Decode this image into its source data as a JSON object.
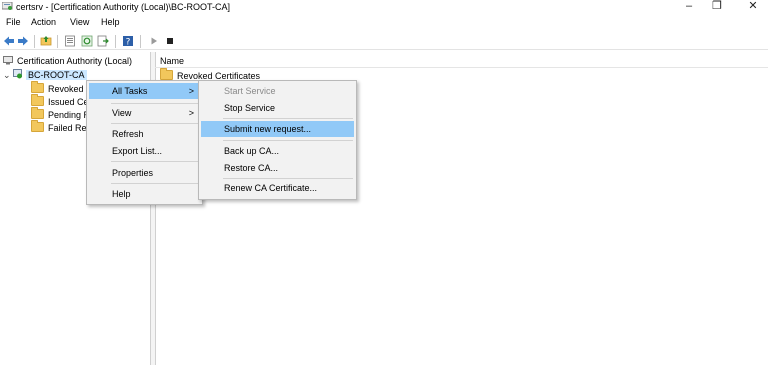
{
  "window": {
    "title": "certsrv - [Certification Authority (Local)\\BC-ROOT-CA]",
    "minimize": "–",
    "restore": "❐",
    "close": "✕"
  },
  "menubar": [
    "File",
    "Action",
    "View",
    "Help"
  ],
  "toolbar": {
    "icons": [
      "back-icon",
      "forward-icon",
      "up-folder-icon",
      "properties-icon",
      "refresh-icon",
      "export-list-icon",
      "help-icon",
      "play-icon",
      "stop-icon"
    ]
  },
  "tree": {
    "root": "Certification Authority (Local)",
    "ca": "BC-ROOT-CA",
    "children": [
      "Revoked C",
      "Issued Cer",
      "Pending R",
      "Failed Req"
    ]
  },
  "list": {
    "column_name": "Name",
    "first_row_partial": "Revoked Certificates"
  },
  "context_menu": {
    "items": [
      "All Tasks",
      "View",
      "Refresh",
      "Export List...",
      "Properties",
      "Help"
    ],
    "submenu_arrow": ">"
  },
  "submenu": {
    "items": [
      "Start Service",
      "Stop Service",
      "Submit new request...",
      "Back up CA...",
      "Restore CA...",
      "Renew CA Certificate..."
    ]
  },
  "colors": {
    "menu_highlight": "#91c9f7",
    "tree_selection": "#cce8ff",
    "menu_bg": "#f2f2f2"
  }
}
